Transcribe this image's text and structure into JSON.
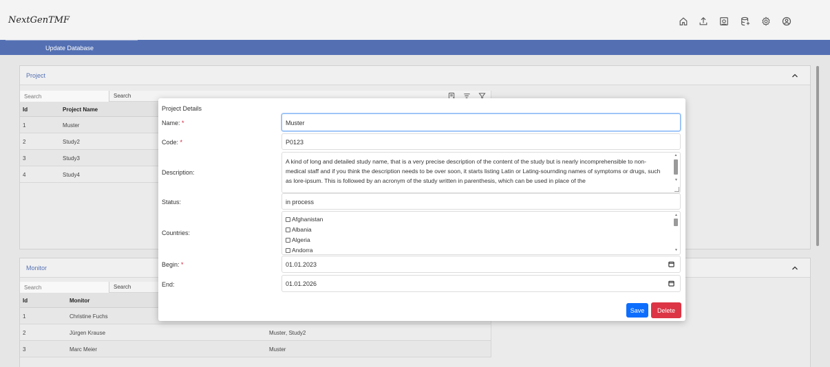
{
  "app": {
    "brand": "NextGenTMF"
  },
  "header_icons": [
    "home-icon",
    "upload-icon",
    "dashboard-icon",
    "database-icon",
    "settings-icon",
    "account-icon"
  ],
  "nav": {
    "active_tab": "Update Database"
  },
  "project_panel": {
    "title": "Project",
    "search_placeholder": "Search",
    "search_button": "Search",
    "columns": [
      "Id",
      "Project Name"
    ],
    "rows": [
      {
        "id": "1",
        "name": "Muster"
      },
      {
        "id": "2",
        "name": "Study2"
      },
      {
        "id": "3",
        "name": "Study3"
      },
      {
        "id": "4",
        "name": "Study4"
      }
    ]
  },
  "monitor_panel": {
    "title": "Monitor",
    "search_placeholder": "Search",
    "search_button": "Search",
    "columns": [
      "Id",
      "Monitor"
    ],
    "rows": [
      {
        "id": "1",
        "name": "Christine Fuchs",
        "projects": ""
      },
      {
        "id": "2",
        "name": "Jürgen Krause",
        "projects": "Muster, Study2"
      },
      {
        "id": "3",
        "name": "Marc Meier",
        "projects": "Muster"
      }
    ]
  },
  "modal": {
    "title": "Project Details",
    "name_label": "Name:",
    "name_value": "Muster",
    "code_label": "Code:",
    "code_value": "P0123",
    "description_label": "Description:",
    "description_value": "A kind of long and detailed study name, that is a very precise description of the content of the study but is nearly incomprehensible to non-medical staff and if you think the description needs to be over soon, it starts listing Latin or Lating-sournding names of symptoms or drugs, such as lore-ipsum. This is followed by an acronym of the study written in parenthesis, which can be used in place of the",
    "status_label": "Status:",
    "status_value": "in process",
    "countries_label": "Countries:",
    "countries": [
      "Afghanistan",
      "Albania",
      "Algeria",
      "Andorra"
    ],
    "begin_label": "Begin:",
    "begin_value": "01.01.2023",
    "end_label": "End:",
    "end_value": "01.01.2026",
    "required_mark": "*",
    "save_label": "Save",
    "delete_label": "Delete"
  },
  "colors": {
    "nav": "#5470b3",
    "save": "#0d6efd",
    "delete": "#dc3545",
    "required": "#d0213b"
  }
}
